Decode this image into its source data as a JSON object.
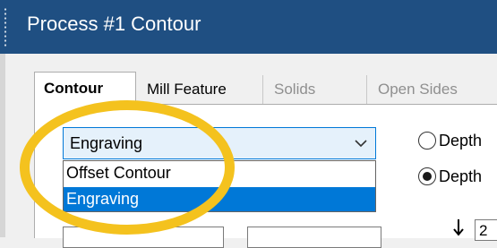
{
  "window": {
    "title": "Process #1 Contour"
  },
  "tabs": [
    {
      "label": "Contour",
      "state": "active"
    },
    {
      "label": "Mill Feature",
      "state": "normal"
    },
    {
      "label": "Solids",
      "state": "disabled"
    },
    {
      "label": "Open Sides",
      "state": "disabled"
    }
  ],
  "contour_type": {
    "selected": "Engraving",
    "options": [
      "Offset Contour",
      "Engraving"
    ]
  },
  "depth_options": [
    {
      "label": "Depth",
      "checked": false
    },
    {
      "label": "Depth",
      "checked": true
    }
  ],
  "bottom": {
    "field_value": "2"
  },
  "colors": {
    "titlebar": "#1f4f82",
    "selection": "#0078d7",
    "highlight_ring": "#f4c21e"
  },
  "icons": {
    "combo_chevron": "chevron-down-icon",
    "depth_arrow": "arrow-down-icon"
  }
}
